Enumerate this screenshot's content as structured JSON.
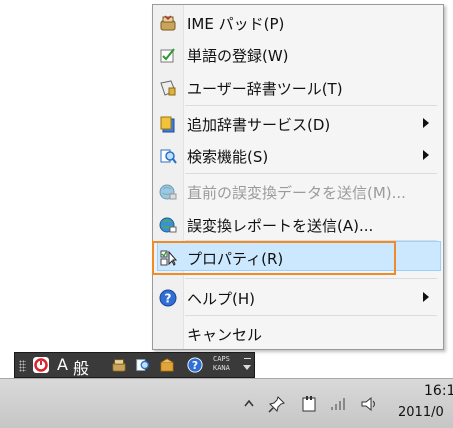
{
  "menu": {
    "items": [
      {
        "label": "IME パッド(P)",
        "icon": "ime-pad-icon"
      },
      {
        "label": "単語の登録(W)",
        "icon": "word-register-icon"
      },
      {
        "label": "ユーザー辞書ツール(T)",
        "icon": "user-dictionary-icon"
      },
      {
        "label": "追加辞書サービス(D)",
        "icon": "dictionary-service-icon",
        "submenu": true
      },
      {
        "label": "検索機能(S)",
        "icon": "search-function-icon",
        "submenu": true
      },
      {
        "label": "直前の誤変換データを送信(M)...",
        "icon": "send-data-icon",
        "disabled": true
      },
      {
        "label": "誤変換レポートを送信(A)...",
        "icon": "send-report-icon"
      },
      {
        "label": "プロパティ(R)",
        "icon": "properties-icon",
        "highlighted": true
      },
      {
        "label": "ヘルプ(H)",
        "icon": "help-icon",
        "submenu": true
      },
      {
        "label": "キャンセル",
        "icon": ""
      }
    ]
  },
  "language_bar": {
    "mode_text": "A",
    "kanji_text": "般",
    "caps_label": "CAPS",
    "kana_label": "KANA"
  },
  "taskbar": {
    "clock_time": "16:1",
    "clock_date": "2011/0"
  },
  "colors": {
    "highlight": "#cce8ff",
    "highlight_border": "#99d1ff",
    "annotation_box": "#f08c28"
  }
}
